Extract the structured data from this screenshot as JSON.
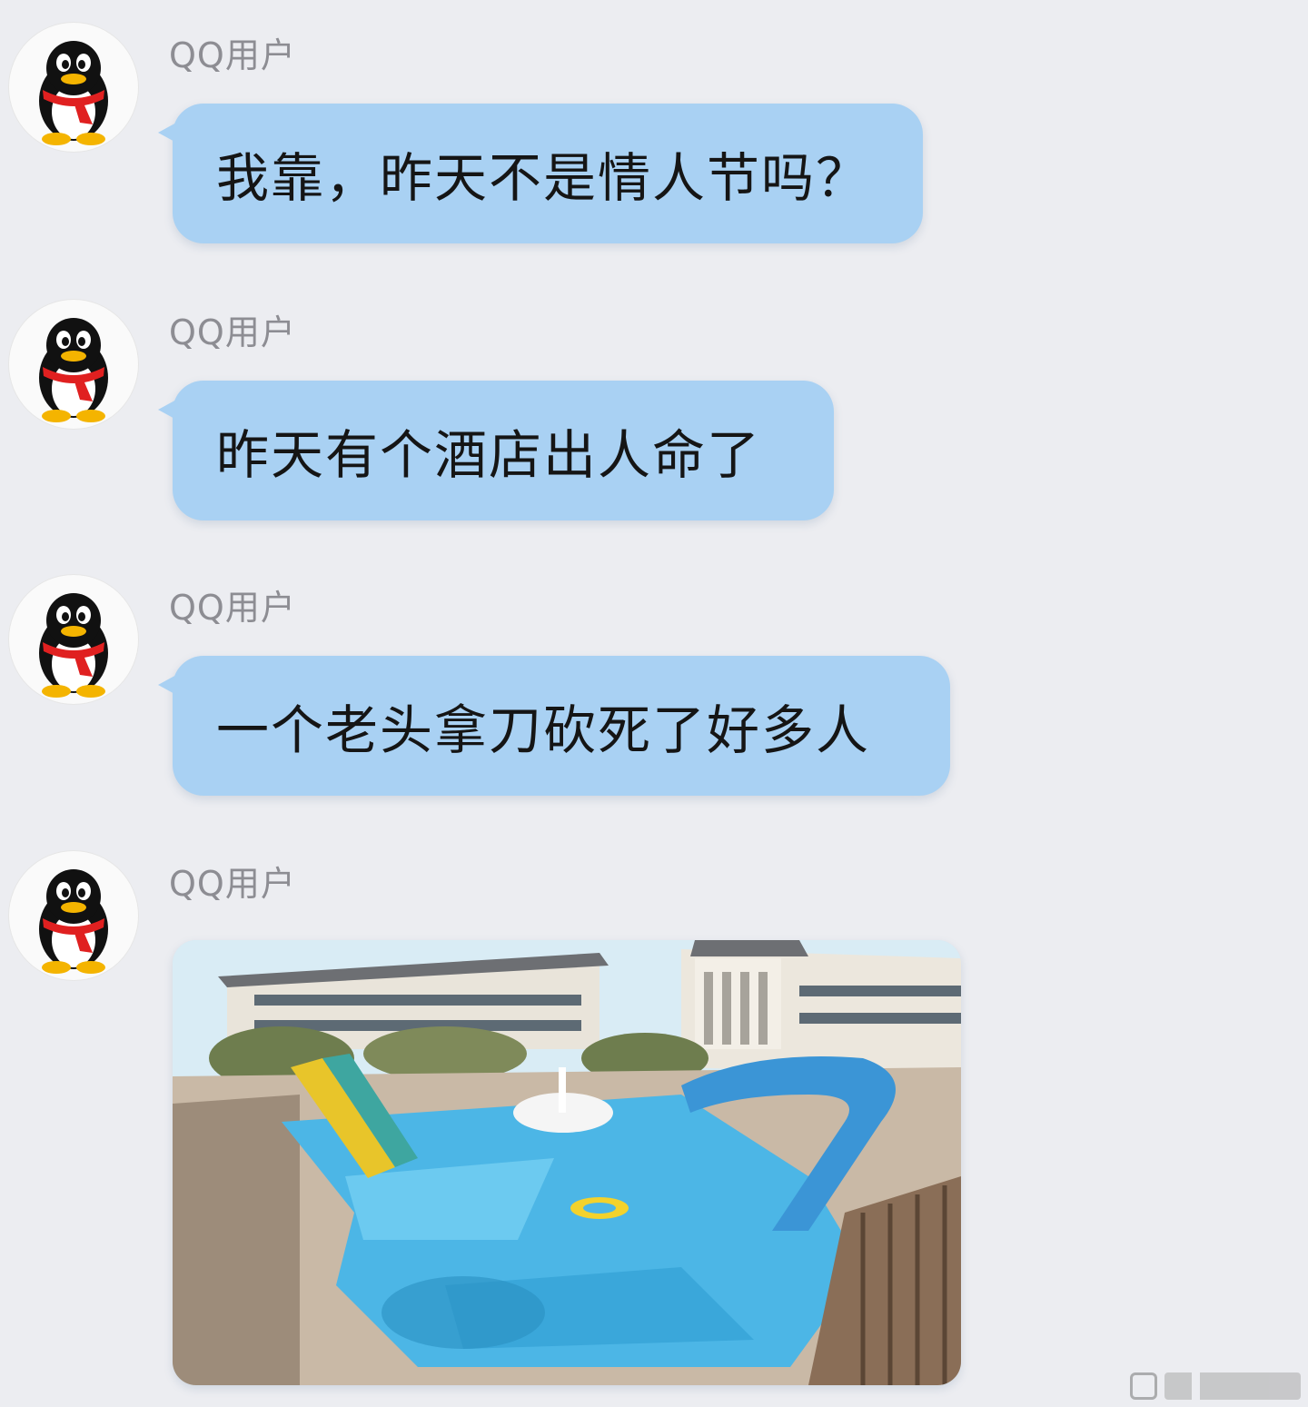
{
  "messages": [
    {
      "sender": "QQ用户",
      "avatar_icon": "qq-penguin-icon",
      "type": "text",
      "text": "我靠，昨天不是情人节吗？"
    },
    {
      "sender": "QQ用户",
      "avatar_icon": "qq-penguin-icon",
      "type": "text",
      "text": "昨天有个酒店出人命了"
    },
    {
      "sender": "QQ用户",
      "avatar_icon": "qq-penguin-icon",
      "type": "text",
      "text": "一个老头拿刀砍死了好多人"
    },
    {
      "sender": "QQ用户",
      "avatar_icon": "qq-penguin-icon",
      "type": "image",
      "image_subject": "hotel-pool-with-water-slides"
    }
  ],
  "colors": {
    "background": "#ecedf1",
    "bubble": "#a9d1f3",
    "sender_name": "#8d8d93",
    "message_text": "#151515"
  },
  "watermark_icon": "video-platform-watermark"
}
